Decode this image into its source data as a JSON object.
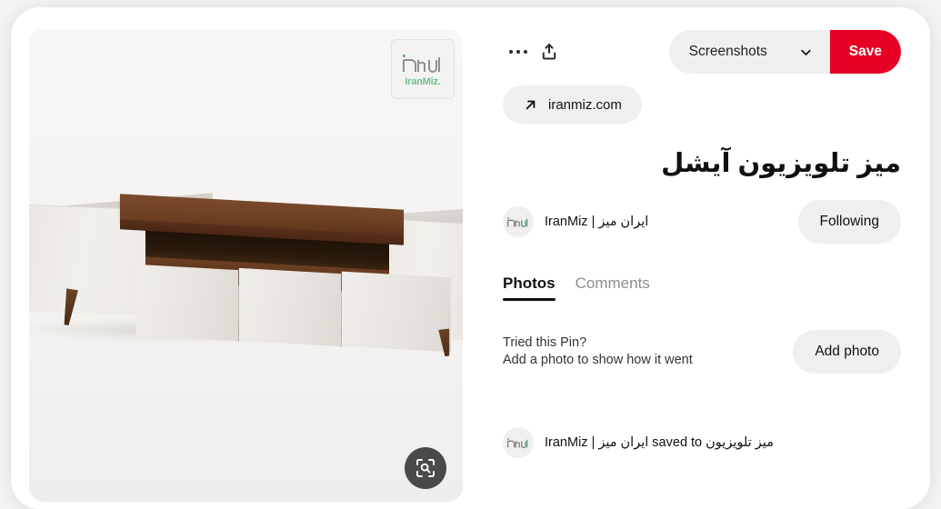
{
  "card": {
    "actions": {
      "more_options": "more-options-icon",
      "share": "share-icon"
    },
    "save": {
      "board_name": "Screenshots",
      "chevron": "chevron-down-icon",
      "save_label": "Save",
      "accent_color": "#e60023"
    },
    "source": {
      "arrow": "external-link-arrow-icon",
      "domain": "iranmiz.com"
    },
    "title": "میز تلویزیون آیشل",
    "creator": {
      "avatar": "iranmiz-avatar",
      "name": "IranMiz | ایران میز",
      "follow_label": "Following"
    },
    "tabs": [
      {
        "label": "Photos",
        "active": true
      },
      {
        "label": "Comments",
        "active": false
      }
    ],
    "tried_prompt": {
      "line1": "Tried this Pin?",
      "line2": "Add a photo to show how it went",
      "button_label": "Add photo"
    },
    "saved_to": {
      "avatar": "iranmiz-avatar",
      "text": "IranMiz | ایران میز saved to میز تلویزیون"
    }
  },
  "media": {
    "watermark": {
      "brand": "IranMiz.",
      "brand_color": "#6fbf8e"
    },
    "visual_search": "visual-search-icon",
    "alt": "White TV stand with dark walnut top panel and open shelf"
  }
}
